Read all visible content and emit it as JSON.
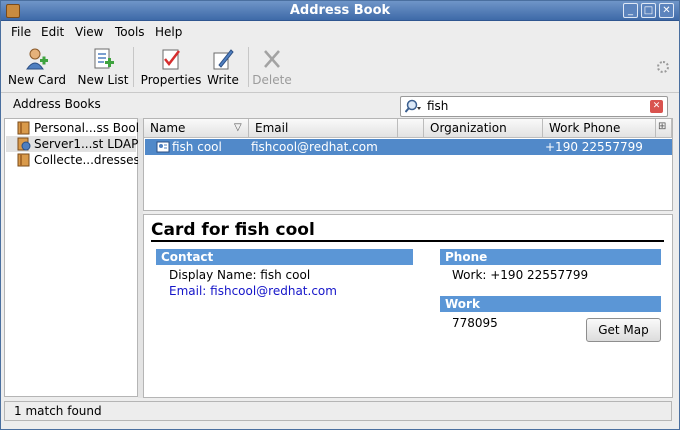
{
  "window": {
    "title": "Address Book",
    "controls": {
      "minimize": "_",
      "maximize": "□",
      "close": "✕"
    }
  },
  "menubar": {
    "items": [
      {
        "label": "File"
      },
      {
        "label": "Edit"
      },
      {
        "label": "View"
      },
      {
        "label": "Tools"
      },
      {
        "label": "Help"
      }
    ]
  },
  "toolbar": {
    "new_card": "New Card",
    "new_list": "New List",
    "properties": "Properties",
    "write": "Write",
    "delete": "Delete"
  },
  "sidebar": {
    "heading": "Address Books",
    "items": [
      {
        "label": "Personal...ss Book",
        "icon": "address-book-icon",
        "selected": false
      },
      {
        "label": "Server1...st LDAP",
        "icon": "ldap-server-icon",
        "selected": true
      },
      {
        "label": "Collecte...dresses",
        "icon": "address-book-icon",
        "selected": false
      }
    ]
  },
  "search": {
    "value": "fish"
  },
  "results": {
    "columns": [
      "Name",
      "Email",
      "Organization",
      "Work Phone"
    ],
    "rows": [
      {
        "name": "fish cool",
        "email": "fishcool@redhat.com",
        "organization": "",
        "work_phone": "+190 22557799"
      }
    ]
  },
  "card": {
    "title": "Card for fish cool",
    "contact_heading": "Contact",
    "display_name": "Display Name: fish cool",
    "email": "Email: fishcool@redhat.com",
    "phone_heading": "Phone",
    "work_phone": "Work: +190 22557799",
    "work_heading": "Work",
    "work_value": "778095",
    "get_map": "Get Map"
  },
  "status": {
    "text": "1 match found"
  },
  "colors": {
    "accent": "#5189c9",
    "section": "#5b96d6",
    "link": "#1515c9"
  }
}
